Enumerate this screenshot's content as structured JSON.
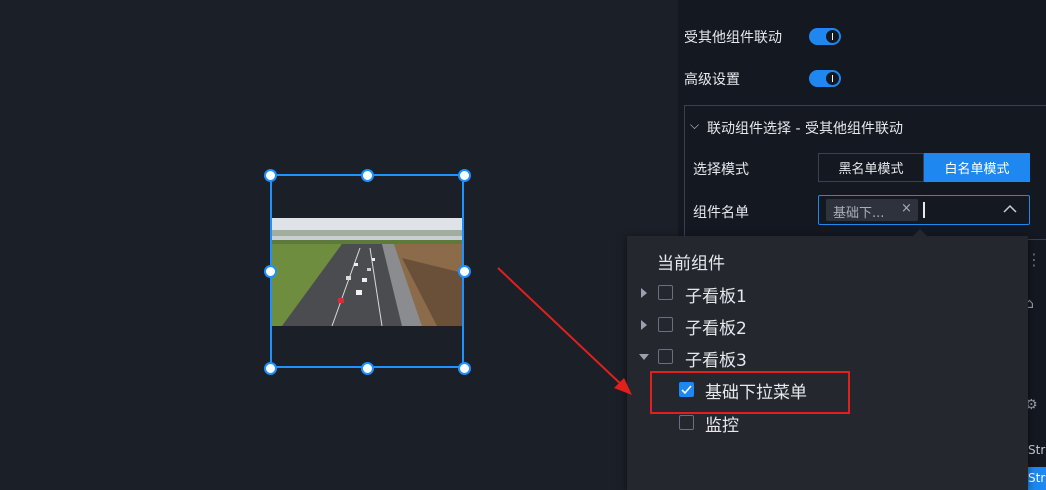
{
  "settings": {
    "linked_by_others_label": "受其他组件联动",
    "linked_by_others_on": true,
    "advanced_label": "高级设置",
    "advanced_on": true
  },
  "link_panel": {
    "title": "联动组件选择 - 受其他组件联动",
    "mode_label": "选择模式",
    "mode_options": [
      "黑名单模式",
      "白名单模式"
    ],
    "mode_selected": "白名单模式",
    "list_label": "组件名单",
    "selected_tag": "基础下...",
    "tag_close": "×"
  },
  "dropdown": {
    "header": "当前组件",
    "items": [
      {
        "label": "子看板1",
        "expanded": false,
        "checked": false
      },
      {
        "label": "子看板2",
        "expanded": false,
        "checked": false
      },
      {
        "label": "子看板3",
        "expanded": true,
        "checked": false
      },
      {
        "label": "基础下拉菜单",
        "checked": true,
        "child": true
      },
      {
        "label": "监控",
        "checked": false,
        "child": true
      }
    ]
  },
  "edge_fragments": [
    "Str",
    "Str"
  ],
  "colors": {
    "accent": "#1e88f0",
    "annotation": "#e0201c",
    "background": "#1b1f27",
    "panel": "#141820"
  }
}
